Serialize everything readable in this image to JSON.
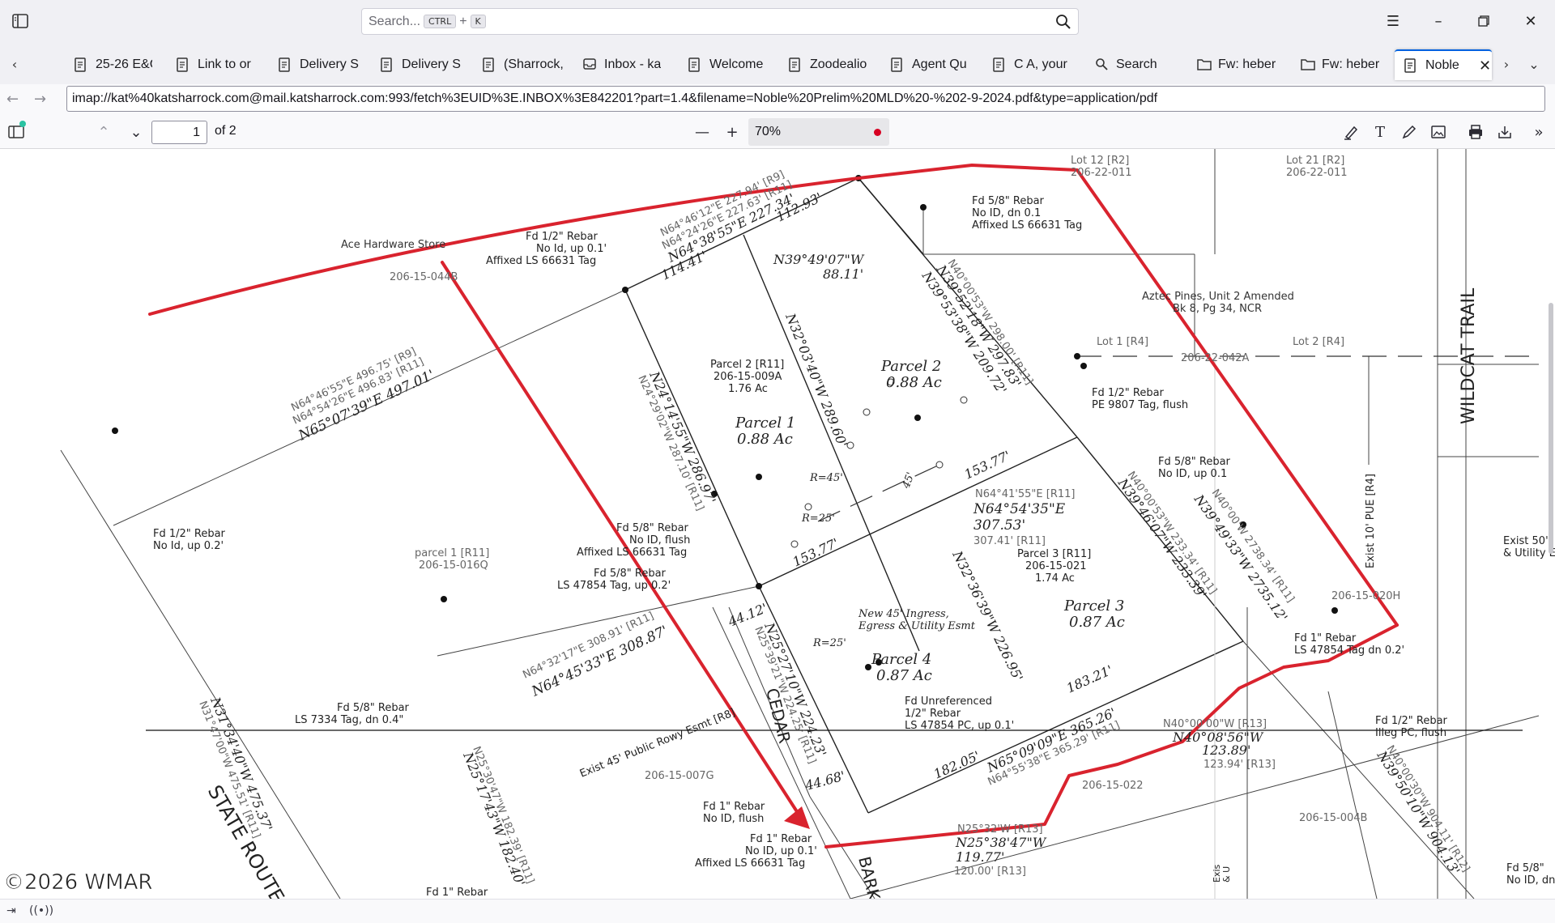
{
  "window": {
    "search_placeholder": "Search...",
    "search_shortcut_1": "CTRL",
    "search_shortcut_plus": "+",
    "search_shortcut_2": "K"
  },
  "tabs": [
    {
      "label": "25-26 E&C"
    },
    {
      "label": "Link to or"
    },
    {
      "label": "Delivery S"
    },
    {
      "label": "Delivery S"
    },
    {
      "label": "(Sharrock,"
    },
    {
      "label": "Inbox - ka"
    },
    {
      "label": "Welcome"
    },
    {
      "label": "Zoodealio"
    },
    {
      "label": "Agent Qu"
    },
    {
      "label": "C A, your"
    },
    {
      "label": "Search"
    },
    {
      "label": "Fw: heber"
    },
    {
      "label": "Fw: heber"
    },
    {
      "label": "Noble"
    }
  ],
  "navbar": {
    "url": "imap://kat%40katsharrock.com@mail.katsharrock.com:993/fetch%3EUID%3E.INBOX%3E842201?part=1.4&filename=Noble%20Prelim%20MLD%20-%202-9-2024.pdf&type=application/pdf"
  },
  "pdf_toolbar": {
    "page_number": "1",
    "page_total": "of 2",
    "zoom": "70%"
  },
  "plat": {
    "top_labels": [
      "Lot 12 [R2]",
      "206-22-011",
      "Lot 21 [R2]",
      "206-22-011"
    ],
    "ace": "Ace Hardware Store",
    "apn_044b": "206-15-044B",
    "rebar_ne": [
      "Fd 5/8\" Rebar",
      "No ID, dn 0.1",
      "Affixed LS 66631 Tag"
    ],
    "rebar_nw": [
      "Fd 1/2\" Rebar",
      "No Id, up 0.1'",
      "Affixed LS 66631 Tag"
    ],
    "brg_top_1": "N64°46'12\"E  227.94' [R9]",
    "brg_top_2": "N64°24'26\"E  227.63' [R11]",
    "brg_top_3": "N64°38'55\"E  227.34'",
    "dist_112": "112.93'",
    "dist_114": "114.41'",
    "brg_n39_49": "N39°49'07\"W",
    "dist_88": "88.11'",
    "brg_north_1": "N40°00'53\"W  298.00' [R11]",
    "brg_north_2": "N39°52'18\"W  297.83'",
    "brg_north_3": "N39°53'38\"W  209.72'",
    "aztec": [
      "Aztec Pines, Unit 2 Amended",
      "Bk 8, Pg 34, NCR"
    ],
    "lot1": "Lot 1 [R4]",
    "lot2": "Lot 2 [R4]",
    "apn_042a": "206-22-042A",
    "wildcat": "WILDCAT TRAIL",
    "parcel2_r11": [
      "Parcel 2 [R11]",
      "206-15-009A",
      "1.76 Ac"
    ],
    "parcel2": [
      "Parcel 2",
      "0.88 Ac"
    ],
    "parcel1": [
      "Parcel 1",
      "0.88 Ac"
    ],
    "parcel3": [
      "Parcel 3",
      "0.87 Ac"
    ],
    "parcel4": [
      "Parcel 4",
      "0.87 Ac"
    ],
    "parcel3_r11": [
      "Parcel 3 [R11]",
      "206-15-021",
      "1.74 Ac"
    ],
    "brg_n32": "N32°03'40\"W  289.60'",
    "brg_w_1": "N64°46'55\"E  496.75' [R9]",
    "brg_w_2": "N64°54'26\"E  496.83' [R11]",
    "brg_w_3": "N65°07'39\"E  497.01'",
    "rebar_pe": [
      "Fd 1/2\" Rebar",
      "PE 9807 Tag, flush"
    ],
    "rebar_58_up": [
      "Fd 5/8\" Rebar",
      "No ID, up 0.1"
    ],
    "rebar_w": [
      "Fd 1/2\" Rebar",
      "No Id, up 0.2'"
    ],
    "parcel1_r11": [
      "parcel 1 [R11]",
      "206-15-016Q"
    ],
    "r45": "R=45'",
    "r25a": "R=25'",
    "r25b": "R=25'",
    "d45": "45'",
    "dist_153a": "153.77'",
    "dist_153b": "153.77'",
    "brg_mid_1": "N64°41'55\"E [R11]",
    "brg_mid_2": "N64°54'35\"E",
    "brg_mid_3": "307.53'",
    "brg_mid_4": "307.41' [R11]",
    "brg_left_1": "N24°14'55\"W  286.97'",
    "brg_left_2": "N24°29'02\"W  287.10' [R11]",
    "rebar_flush": [
      "Fd 5/8\" Rebar",
      "No ID, flush",
      "Affixed LS 66631 Tag"
    ],
    "rebar_47854": [
      "Fd 5/8\" Rebar",
      "LS 47854 Tag, up 0.2'"
    ],
    "brg_40_a": "N40°00'53\"W  233.34' [R11]",
    "brg_40_b": "N39°46'07\"W  233.39'",
    "brg_40_c": "N40°00'W  2738.34' [R11]",
    "brg_40_d": "N39°49'33\"W  2735.12'",
    "exist10": "Exist 10' PUE [R4]",
    "exist50": [
      "Exist 50'",
      "& Utility E"
    ],
    "apn_020h": "206-15-020H",
    "new45": [
      "New 45' Ingress,",
      "Egress & Utility Esmt"
    ],
    "brg_n32_36": "N32°36'39\"W  226.95'",
    "dist_44": "44.12'",
    "brg_sw_1": "N64°32'17\"E  308.91' [R11]",
    "brg_sw_2": "N64°45'33\"E  308.87'",
    "brg_25_a": "N25°39'21\"W  224.25' [R11]",
    "brg_25_b": "N25°27'10\"W  224.23'",
    "rebar_1in_dn": [
      "Fd 1\" Rebar",
      "LS 47854 Tag dn 0.2'"
    ],
    "dist_183": "183.21'",
    "rebar_7334": [
      "Fd 5/8\" Rebar",
      "LS 7334 Tag, dn 0.4\""
    ],
    "cedar": "CEDAR",
    "exist45": "Exist 45' Public Rowy Esmt [R8]",
    "apn_007g": "206-15-007G",
    "unref": [
      "Fd Unreferenced",
      "1/2\" Rebar",
      "LS 47854 PC, up 0.1'"
    ],
    "brg_n40_r13": "N40°00'00\"W [R13]",
    "brg_n40_08": "N40°08'56\"W",
    "dist_123": "123.89'",
    "dist_123r": "123.94' [R13]",
    "rebar_illeg": [
      "Fd 1/2\" Rebar",
      "Illeg PC, flush"
    ],
    "dist_182": "182.05'",
    "brg_s_1": "N65°09'09\"E  365.26'",
    "brg_s_2": "N64°55'38\"E  365.29' [R11]",
    "apn_022": "206-15-022",
    "dist_44_68": "44.68'",
    "rebar_flush2": [
      "Fd 1\" Rebar",
      "No ID, flush"
    ],
    "rebar_bottom": [
      "Fd 1\" Rebar",
      "No ID, up 0.1'",
      "Affixed LS 66631 Tag"
    ],
    "brg_n25_r13": "N25°32'W [R13]",
    "brg_n25_38": "N25°38'47\"W",
    "dist_119": "119.77'",
    "dist_120": "120.00' [R13]",
    "apn_004b": "206-15-004B",
    "brg_se_1": "N40°00'30\"W  904.11' [R12]",
    "brg_se_2": "N39°50'10\"W  904.13'",
    "brg_n31_1": "N31°34'40\"W  475.37'",
    "brg_n31_2": "N31°47'00\"W  475.51' [R11]",
    "brg_n25_30_1": "N25°30'47\"W  182.39' [R11]",
    "brg_n25_30_2": "N25°17'43\"W  182.40'",
    "state_route": "STATE ROUTE",
    "bark": "BARK",
    "rebar_bl": "Fd 1\" Rebar",
    "rebar_br": [
      "Fd 5/8\"",
      "No ID, dn"
    ],
    "exis": [
      "Exis",
      "& U"
    ],
    "watermark": "©2026  WMAR"
  },
  "colors": {
    "annotation_red": "#d9232e",
    "accent_blue": "#0061e0"
  },
  "icons": [
    "sidebar-toggle-icon",
    "search-icon",
    "menu-icon",
    "minimize-icon",
    "restore-icon",
    "close-icon",
    "pdf-tab-icon",
    "back-icon",
    "forward-icon",
    "highlight-icon",
    "text-icon",
    "draw-icon",
    "image-icon",
    "print-icon",
    "save-icon",
    "more-tools-icon"
  ]
}
